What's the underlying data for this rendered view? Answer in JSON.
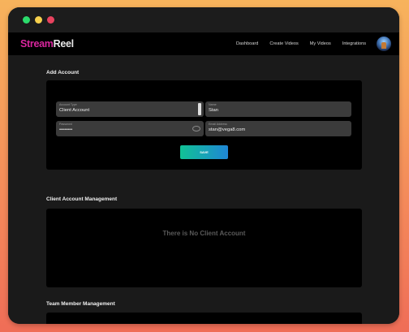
{
  "app": {
    "logo_part1": "Stream",
    "logo_part2": "Reel"
  },
  "nav": {
    "items": [
      {
        "label": "Dashboard"
      },
      {
        "label": "Create Videos"
      },
      {
        "label": "My Videos"
      },
      {
        "label": "Integrations"
      }
    ]
  },
  "add_account": {
    "title": "Add Account",
    "account_type": {
      "label": "Account Type",
      "value": "Client Account"
    },
    "name": {
      "label": "Name",
      "value": "Stan"
    },
    "password": {
      "label": "Password",
      "value": "••••••••"
    },
    "email": {
      "label": "Email Address",
      "value": "stan@vega8.com"
    },
    "save_label": "SAVE"
  },
  "client_management": {
    "title": "Client Account Management",
    "empty_message": "There is No Client Account"
  },
  "team_management": {
    "title": "Team Member Management"
  },
  "colors": {
    "brand_pink": "#d9269e",
    "button_gradient_start": "#11c295",
    "button_gradient_end": "#1f86d6"
  }
}
